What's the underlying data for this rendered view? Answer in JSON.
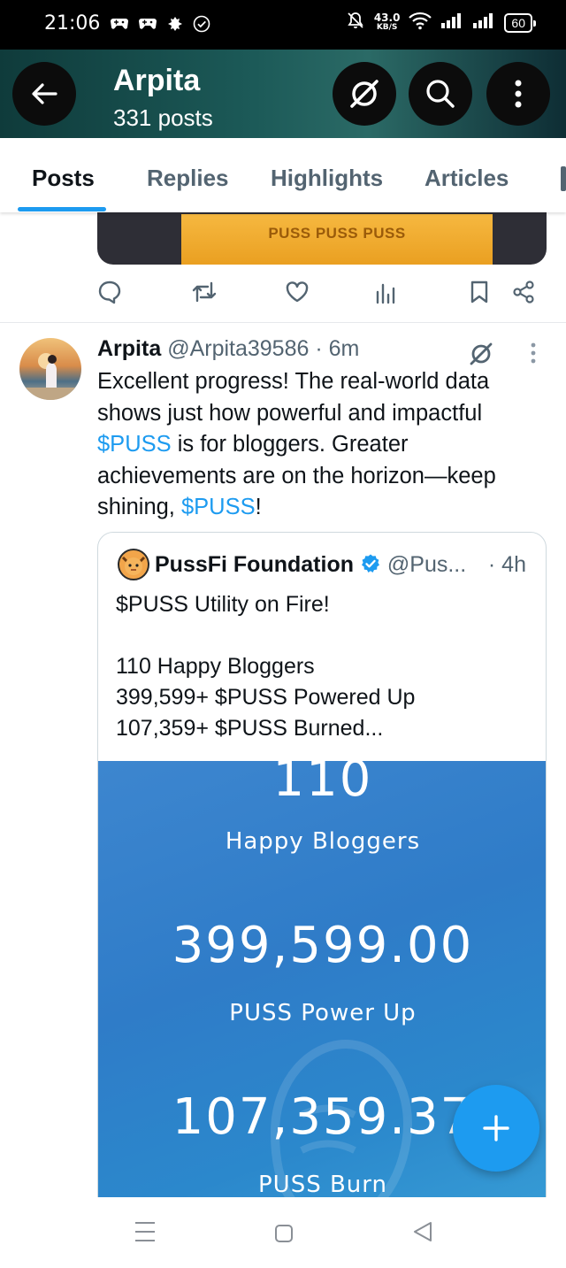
{
  "status_bar": {
    "time": "21:06",
    "speed_value": "43.0",
    "speed_unit": "KB/S",
    "battery": "60"
  },
  "header": {
    "title": "Arpita",
    "subtitle": "331 posts"
  },
  "tabs": [
    {
      "label": "Posts",
      "active": true
    },
    {
      "label": "Replies",
      "active": false
    },
    {
      "label": "Highlights",
      "active": false
    },
    {
      "label": "Articles",
      "active": false
    }
  ],
  "previous_post": {
    "media_text": "PUSS PUSS PUSS"
  },
  "post": {
    "author_name": "Arpita",
    "handle_time": "@Arpita39586 · 6m",
    "text_1": "Excellent progress! The real-world data shows just how powerful and impactful ",
    "tag_1": "$PUSS",
    "text_2": " is for bloggers. Greater achievements are on the horizon—keep shining, ",
    "tag_2": "$PUSS",
    "text_3": "!"
  },
  "quote": {
    "author_name": "PussFi Foundation",
    "handle": "@Pus...",
    "time": "· 4h",
    "text": "$PUSS Utility on Fire!\n\n110 Happy Bloggers\n399,599+ $PUSS Powered Up\n107,359+ $PUSS Burned...",
    "image": {
      "stat_1_value": "110",
      "stat_1_label": "Happy Bloggers",
      "stat_2_value": "399,599.00",
      "stat_2_label": "PUSS Power Up",
      "stat_3_value": "107,359.37",
      "stat_3_label": "PUSS Burn"
    }
  },
  "colors": {
    "accent": "#1d9bf0",
    "header_bg": "#1c5a58",
    "secondary_text": "#536471"
  }
}
